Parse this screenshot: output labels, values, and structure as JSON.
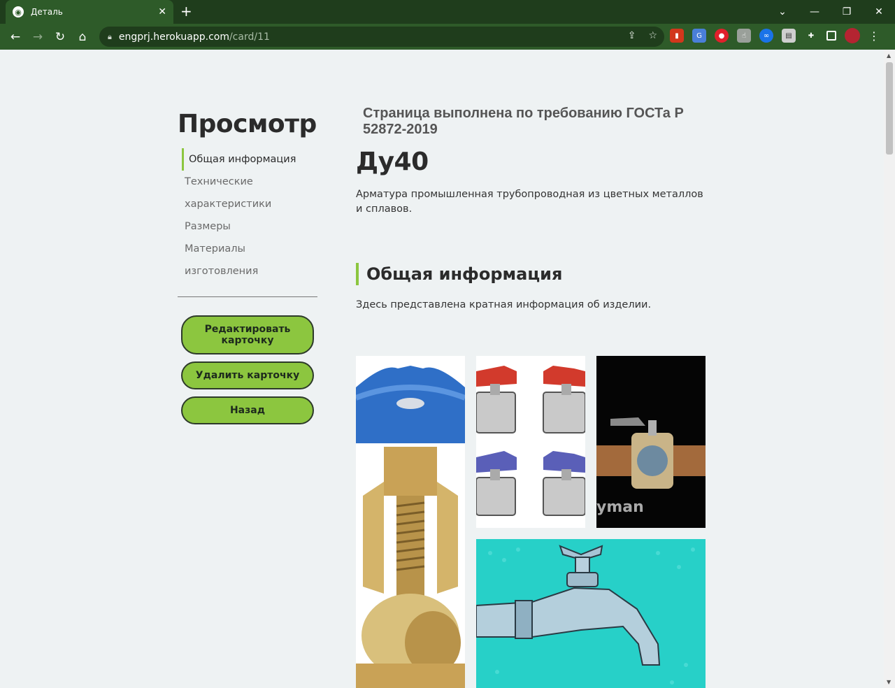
{
  "browser": {
    "tab_title": "Деталь",
    "tab_close": "✕",
    "new_tab": "+",
    "url_host": "engprj.herokuapp.com",
    "url_path": "/card/11",
    "controls": {
      "dropdown": "⌄",
      "minimize": "—",
      "restore": "❐",
      "close": "✕"
    }
  },
  "sidebar": {
    "title": "Просмотр",
    "nav": [
      {
        "label": "Общая информация",
        "active": true
      },
      {
        "label": "Технические"
      },
      {
        "label": "характеристики"
      },
      {
        "label": "Размеры"
      },
      {
        "label": "Материалы изготовления"
      }
    ],
    "buttons": {
      "edit": "Редактировать карточку",
      "delete": "Удалить карточку",
      "back": "Назад"
    }
  },
  "main": {
    "gost_note": "Страница выполнена по требованию ГОСТа Р 52872-2019",
    "heading": "Ду40",
    "description": "Арматура промышленная трубопроводная из цветных металлов и сплавов.",
    "section_title": "Общая информация",
    "section_text": "Здесь представлена кратная информация об изделии."
  },
  "gallery": {
    "watermark": "yman"
  },
  "colors": {
    "accent": "#8cc63f",
    "chrome_dark": "#1f3d1c",
    "chrome": "#2e5b29",
    "page_bg": "#eef2f3"
  },
  "icons": [
    "back-icon",
    "forward-icon",
    "reload-icon",
    "home-icon",
    "lock-icon",
    "share-icon",
    "star-icon",
    "extensions-icon",
    "sidebar-icon",
    "menu-icon"
  ]
}
